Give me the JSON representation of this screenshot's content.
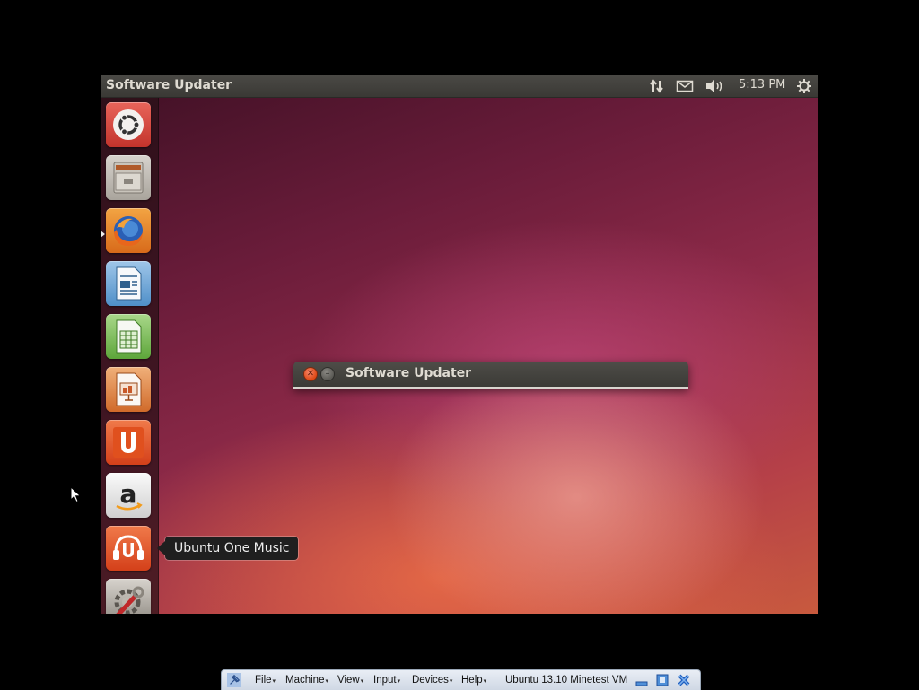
{
  "panel": {
    "title": "Software Updater",
    "clock": "5:13 PM",
    "tray_icons": [
      "network-transfer-icon",
      "mail-icon",
      "volume-icon",
      "gear-icon"
    ]
  },
  "launcher": {
    "items": [
      {
        "name": "dash-home",
        "icon": "ubuntu-logo-icon"
      },
      {
        "name": "files",
        "icon": "file-cabinet-icon"
      },
      {
        "name": "firefox",
        "icon": "firefox-icon",
        "running": true
      },
      {
        "name": "libreoffice-writer",
        "icon": "writer-icon"
      },
      {
        "name": "libreoffice-calc",
        "icon": "calc-icon"
      },
      {
        "name": "libreoffice-impress",
        "icon": "impress-icon"
      },
      {
        "name": "ubuntu-one",
        "icon": "ubuntu-one-icon"
      },
      {
        "name": "amazon",
        "icon": "amazon-icon"
      },
      {
        "name": "ubuntu-one-music",
        "icon": "headphones-icon"
      },
      {
        "name": "system-settings",
        "icon": "wrench-gear-icon"
      }
    ],
    "tooltip": "Ubuntu One Music"
  },
  "dialog": {
    "title": "Software Updater"
  },
  "vbox": {
    "menus": [
      "File",
      "Machine",
      "View",
      "Input",
      "Devices",
      "Help"
    ],
    "vm_name": "Ubuntu 13.10 Minetest VM"
  },
  "colors": {
    "panel_bg": "#3c3b37",
    "ubuntu_orange": "#dd4814",
    "vbox_bar": "#dce3ec"
  }
}
